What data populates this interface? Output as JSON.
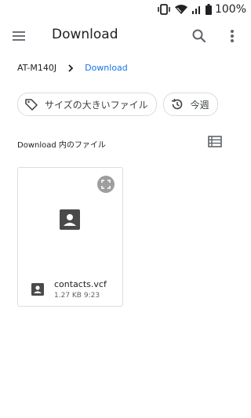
{
  "status": {
    "battery": "100%"
  },
  "appbar": {
    "title": "Download"
  },
  "breadcrumb": {
    "device": "AT-M140J",
    "current": "Download"
  },
  "chips": [
    {
      "label": "サイズの大きいファイル",
      "icon": "tag-icon"
    },
    {
      "label": "今週",
      "icon": "history-icon"
    }
  ],
  "section": {
    "label": "Download 内のファイル"
  },
  "files": [
    {
      "name": "contacts.vcf",
      "size": "1.27 KB",
      "time": "9:23",
      "meta": "1.27 KB  9:23",
      "icon": "contact-card-icon"
    }
  ]
}
